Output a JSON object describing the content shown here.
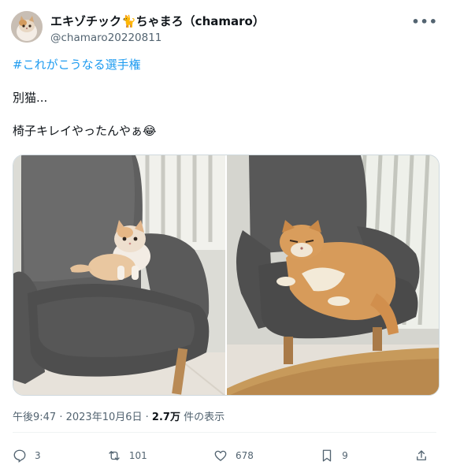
{
  "author": {
    "display_name": "エキゾチック🐈ちゃまろ（chamaro）",
    "handle": "@chamaro20220811",
    "avatar_icon": "cat-avatar-icon"
  },
  "menu": {
    "more_label": "•••"
  },
  "tweet": {
    "hashtag": "#これがこうなる選手権",
    "line2": "別猫...",
    "line3": "椅子キレイやったんやぁ😂"
  },
  "media": {
    "left_photo_alt": "small kitten on grey armchair",
    "right_photo_alt": "grown cat lying on grey armchair"
  },
  "meta": {
    "time": "午後9:47",
    "separator": " · ",
    "date": "2023年10月6日",
    "views_count": "2.7万",
    "views_label": " 件の表示"
  },
  "actions": {
    "replies": "3",
    "retweets": "101",
    "likes": "678",
    "bookmarks": "9"
  },
  "colors": {
    "hashtag": "#1d9bf0",
    "muted": "#536471",
    "text": "#0f1419"
  }
}
